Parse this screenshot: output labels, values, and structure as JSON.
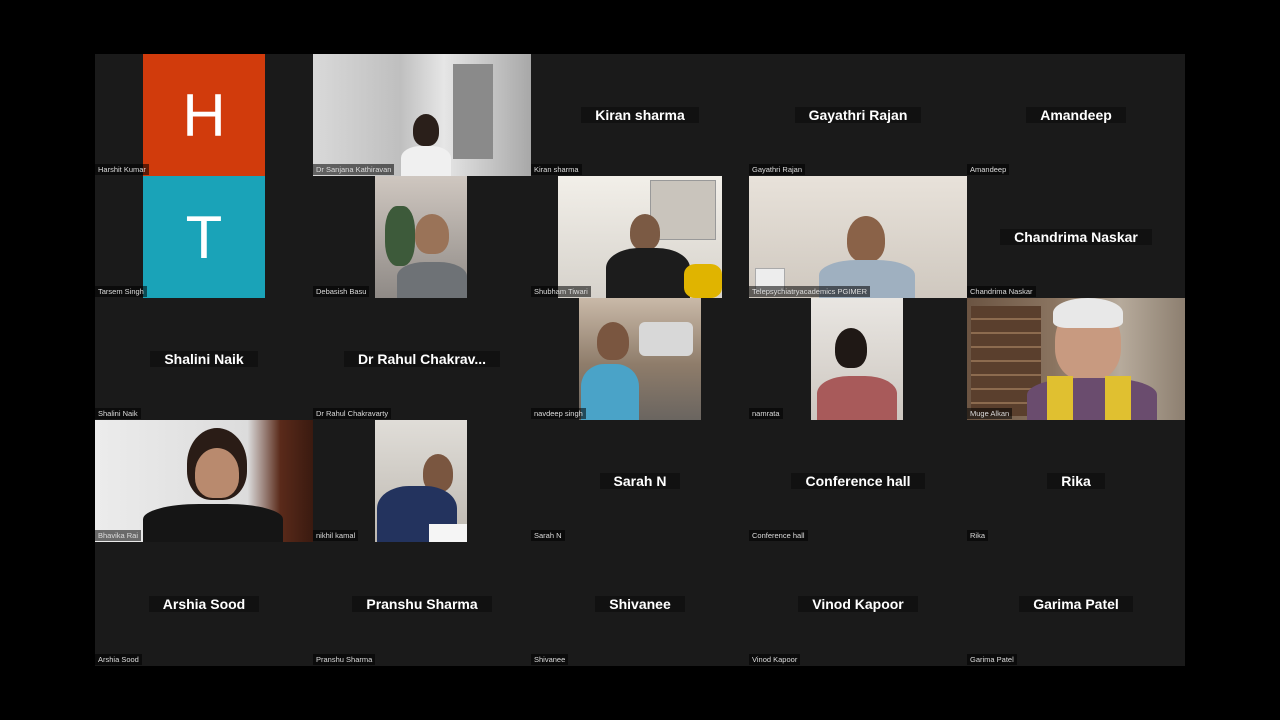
{
  "participants": [
    {
      "display": "",
      "tag": "Harshit Kumar",
      "avatar_letter": "H",
      "avatar_color": "#d13b0c"
    },
    {
      "display": "",
      "tag": "Dr Sanjana Kathiravan"
    },
    {
      "display": "Kiran sharma",
      "tag": "Kiran sharma"
    },
    {
      "display": "Gayathri Rajan",
      "tag": "Gayathri Rajan"
    },
    {
      "display": "Amandeep",
      "tag": "Amandeep"
    },
    {
      "display": "",
      "tag": "Tarsem Singh",
      "avatar_letter": "T",
      "avatar_color": "#1aa3b8"
    },
    {
      "display": "",
      "tag": "Debasish Basu"
    },
    {
      "display": "",
      "tag": "Shubham Tiwari"
    },
    {
      "display": "",
      "tag": "Telepsychiatryacademics PGIMER"
    },
    {
      "display": "Chandrima Naskar",
      "tag": "Chandrima Naskar"
    },
    {
      "display": "Shalini Naik",
      "tag": "Shalini Naik"
    },
    {
      "display": "Dr Rahul Chakrav...",
      "tag": "Dr Rahul Chakravarty"
    },
    {
      "display": "",
      "tag": "navdeep singh"
    },
    {
      "display": "",
      "tag": "namrata"
    },
    {
      "display": "",
      "tag": "Muge Alkan"
    },
    {
      "display": "",
      "tag": "Bhavika Rai"
    },
    {
      "display": "",
      "tag": "nikhil kamal"
    },
    {
      "display": "Sarah N",
      "tag": "Sarah N"
    },
    {
      "display": "Conference hall",
      "tag": "Conference hall"
    },
    {
      "display": "Rika",
      "tag": "Rika"
    },
    {
      "display": "Arshia Sood",
      "tag": "Arshia Sood"
    },
    {
      "display": "Pranshu Sharma",
      "tag": "Pranshu Sharma"
    },
    {
      "display": "Shivanee",
      "tag": "Shivanee"
    },
    {
      "display": "Vinod Kapoor",
      "tag": "Vinod Kapoor"
    },
    {
      "display": "Garima Patel",
      "tag": "Garima Patel"
    }
  ]
}
